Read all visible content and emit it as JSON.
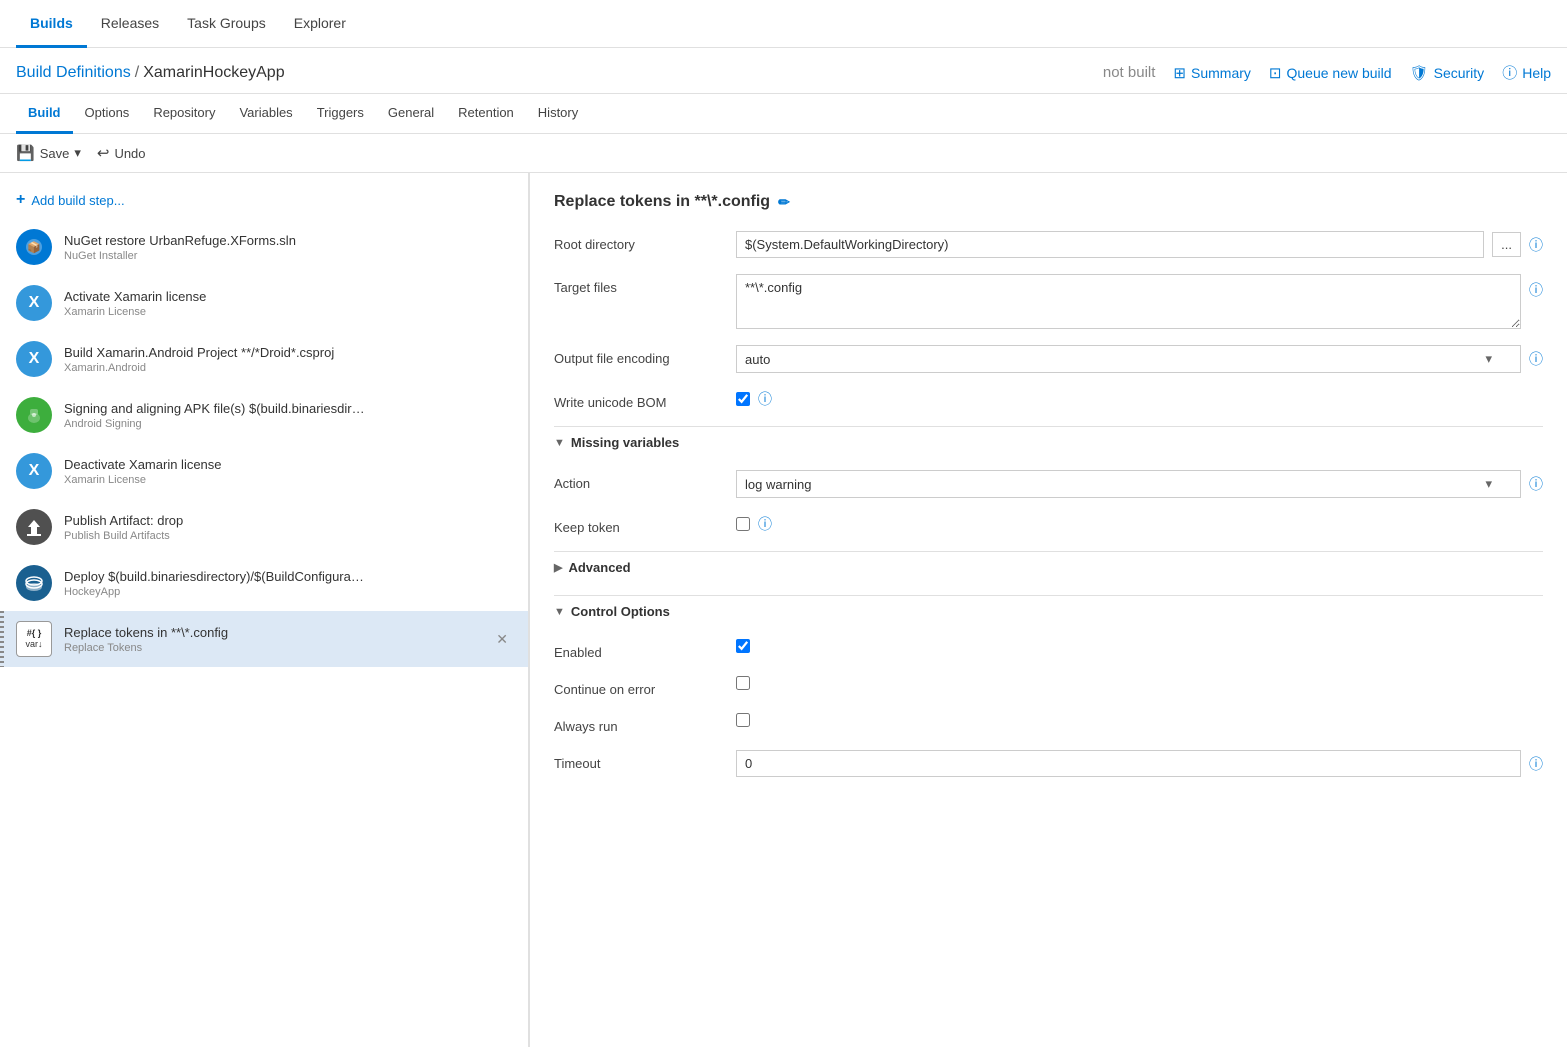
{
  "topNav": {
    "items": [
      {
        "label": "Builds",
        "active": true
      },
      {
        "label": "Releases",
        "active": false
      },
      {
        "label": "Task Groups",
        "active": false
      },
      {
        "label": "Explorer",
        "active": false
      }
    ]
  },
  "header": {
    "breadcrumb_link": "Build Definitions",
    "breadcrumb_sep": "/",
    "breadcrumb_current": "XamarinHockeyApp",
    "status": "not built",
    "actions": [
      {
        "icon": "table-icon",
        "label": "Summary"
      },
      {
        "icon": "queue-icon",
        "label": "Queue new build"
      },
      {
        "icon": "security-icon",
        "label": "Security"
      },
      {
        "icon": "help-icon",
        "label": "Help"
      }
    ]
  },
  "subNav": {
    "items": [
      {
        "label": "Build",
        "active": true
      },
      {
        "label": "Options",
        "active": false
      },
      {
        "label": "Repository",
        "active": false
      },
      {
        "label": "Variables",
        "active": false
      },
      {
        "label": "Triggers",
        "active": false
      },
      {
        "label": "General",
        "active": false
      },
      {
        "label": "Retention",
        "active": false
      },
      {
        "label": "History",
        "active": false
      }
    ]
  },
  "toolbar": {
    "save_label": "Save",
    "save_dropdown": "▾",
    "undo_label": "Undo"
  },
  "buildSteps": {
    "add_label": "Add build step...",
    "steps": [
      {
        "id": "nuget",
        "icon_type": "blue",
        "icon_char": "📦",
        "title": "NuGet restore UrbanRefuge.XForms.sln",
        "subtitle": "NuGet Installer"
      },
      {
        "id": "xamarin-activate",
        "icon_type": "teal",
        "icon_char": "✕",
        "title": "Activate Xamarin license",
        "subtitle": "Xamarin License"
      },
      {
        "id": "android-build",
        "icon_type": "teal",
        "icon_char": "✕",
        "title": "Build Xamarin.Android Project **/*Droid*.csproj",
        "subtitle": "Xamarin.Android"
      },
      {
        "id": "apk-sign",
        "icon_type": "green",
        "icon_char": "🤖",
        "title": "Signing and aligning APK file(s) $(build.binariesdir…",
        "subtitle": "Android Signing"
      },
      {
        "id": "xamarin-deactivate",
        "icon_type": "teal",
        "icon_char": "✕",
        "title": "Deactivate Xamarin license",
        "subtitle": "Xamarin License"
      },
      {
        "id": "publish",
        "icon_type": "gray",
        "icon_char": "⬆",
        "title": "Publish Artifact: drop",
        "subtitle": "Publish Build Artifacts"
      },
      {
        "id": "deploy",
        "icon_type": "dark-blue",
        "icon_char": "🪣",
        "title": "Deploy $(build.binariesdirectory)/$(BuildConfigura…",
        "subtitle": "HockeyApp"
      },
      {
        "id": "replace-tokens",
        "icon_type": "replace",
        "icon_char": "#{}\nvar↓",
        "title": "Replace tokens in **\\*.config",
        "subtitle": "Replace Tokens",
        "active": true
      }
    ]
  },
  "rightPanel": {
    "title": "Replace tokens in **\\*.config",
    "edit_icon": "✏",
    "fields": {
      "root_directory_label": "Root directory",
      "root_directory_value": "$(System.DefaultWorkingDirectory)",
      "target_files_label": "Target files",
      "target_files_value": "**\\*.config",
      "output_encoding_label": "Output file encoding",
      "output_encoding_value": "auto",
      "write_unicode_bom_label": "Write unicode BOM"
    },
    "missing_variables": {
      "header": "Missing variables",
      "action_label": "Action",
      "action_value": "log warning",
      "keep_token_label": "Keep token"
    },
    "advanced": {
      "header": "Advanced"
    },
    "control_options": {
      "header": "Control Options",
      "enabled_label": "Enabled",
      "enabled_checked": true,
      "continue_on_error_label": "Continue on error",
      "continue_on_error_checked": false,
      "always_run_label": "Always run",
      "always_run_checked": false,
      "timeout_label": "Timeout",
      "timeout_value": "0"
    }
  }
}
